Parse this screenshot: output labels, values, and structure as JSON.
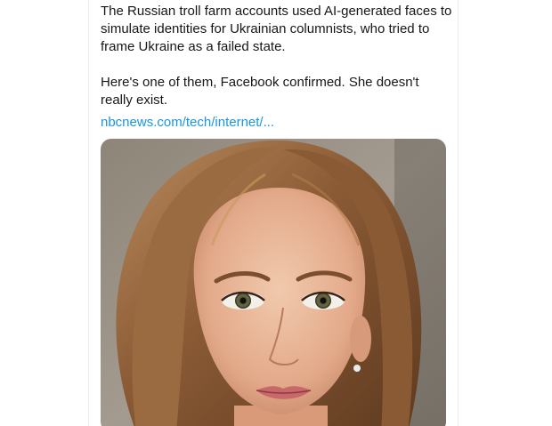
{
  "tweet": {
    "paragraph_1": "The Russian troll farm accounts used AI-generated faces to simulate identities for Ukrainian columnists, who tried to frame Ukraine as a failed state.",
    "paragraph_2": "Here's one of them, Facebook confirmed. She doesn't really exist.",
    "link_text": "nbcnews.com/tech/internet/..."
  },
  "colors": {
    "text": "#14171a",
    "link": "#1b95e0",
    "border": "#e6ecf0"
  }
}
